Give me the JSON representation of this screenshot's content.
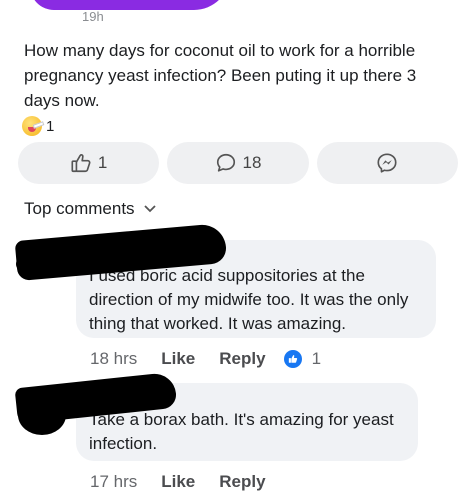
{
  "post": {
    "time": "19h",
    "text": "How many days for coconut oil to work for a horrible pregnancy yeast infection? Been puting it up there 3 days now.",
    "reaction_icon": "sick-face-emoji-icon",
    "reaction_count": "1"
  },
  "actions": {
    "like_count": "1",
    "comment_count": "18",
    "like_icon": "thumbs-up-icon",
    "comment_icon": "comment-bubble-icon",
    "messenger_icon": "messenger-icon"
  },
  "sort": {
    "label": "Top comments",
    "icon": "chevron-down-icon"
  },
  "comments": [
    {
      "text": "I used boric acid suppositories at the direction of my midwife too. It was the only thing that worked. It was amazing.",
      "time": "18 hrs",
      "like_label": "Like",
      "reply_label": "Reply",
      "reaction_count": "1"
    },
    {
      "text": "Take a borax bath. It's amazing for yeast infection.",
      "time": "17 hrs",
      "like_label": "Like",
      "reply_label": "Reply"
    }
  ],
  "colors": {
    "accent_blue": "#1877f2",
    "button_bg": "#eff0f2",
    "bubble_bg": "#f0f2f5",
    "redaction": "#000000",
    "top_blob": "#8a2be2"
  }
}
